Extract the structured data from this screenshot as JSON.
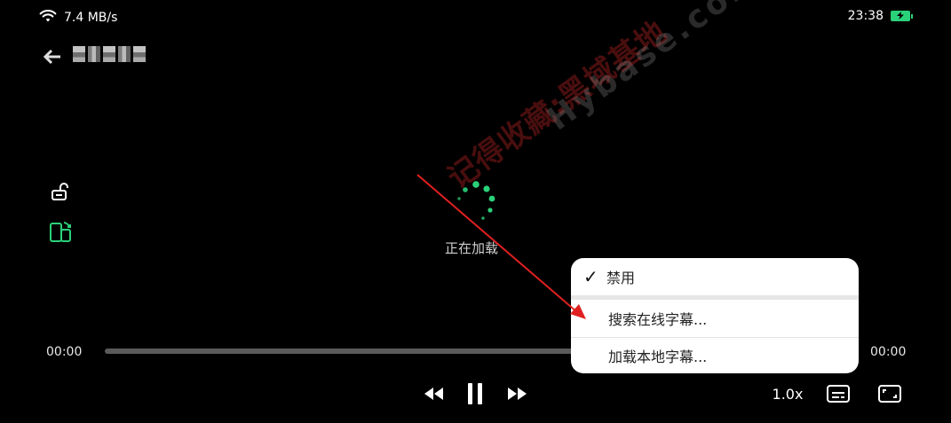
{
  "status_bar": {
    "network_speed": "7.4 MB/s",
    "time": "23:38",
    "wifi_icon": "wifi-icon",
    "battery_icon": "battery-charging-icon",
    "battery_color": "#2bd17a"
  },
  "header": {
    "back_icon": "arrow-left-icon",
    "title": "",
    "title_pixelated": true
  },
  "side_controls": {
    "lock_icon": "unlock-icon",
    "rotate_icon": "screen-rotate-icon",
    "rotate_color": "#2bd17a"
  },
  "watermark": {
    "line1": "记得收藏:黑域基地",
    "line2": "Hybase.com"
  },
  "loading": {
    "text": "正在加载",
    "spinner_color": "#2bd17a"
  },
  "player": {
    "current_time": "00:00",
    "total_time": "00:00",
    "progress": 0,
    "speed_label": "1.0x",
    "rewind_icon": "rewind-icon",
    "pause_icon": "pause-icon",
    "fast_forward_icon": "fast-forward-icon",
    "subtitle_icon": "subtitle-icon",
    "fullscreen_icon": "fullscreen-icon"
  },
  "subtitle_menu": {
    "items": [
      {
        "label": "禁用",
        "checked": true
      },
      {
        "label": "搜索在线字幕...",
        "checked": false
      },
      {
        "label": "加载本地字幕...",
        "checked": false
      }
    ],
    "check_mark": "✓"
  },
  "annotation": {
    "arrow_color": "#e02020"
  }
}
